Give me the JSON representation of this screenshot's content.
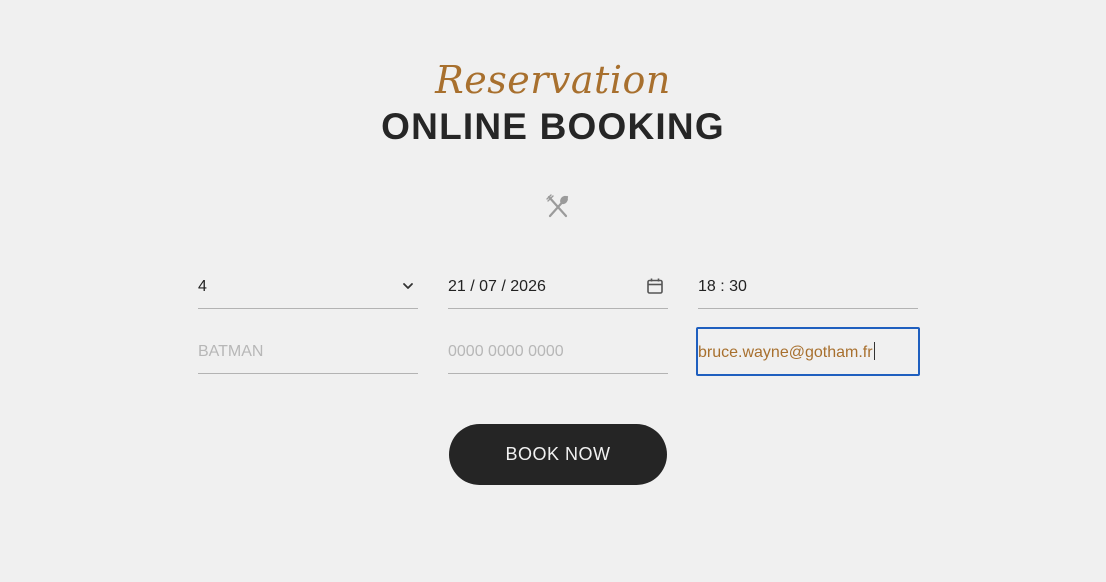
{
  "header": {
    "script_title": "Reservation",
    "title": "ONLINE BOOKING",
    "divider_icon": "fork-knife-icon"
  },
  "form": {
    "guests": {
      "value": "4",
      "icon": "chevron-down-icon"
    },
    "date": {
      "value": "21 / 07 / 2026",
      "icon": "calendar-icon"
    },
    "time": {
      "value": "18 : 30"
    },
    "name": {
      "value": "",
      "placeholder": "BATMAN"
    },
    "phone": {
      "value": "",
      "placeholder": "0000 0000 0000"
    },
    "email": {
      "value": "bruce.wayne@gotham.fr",
      "focused": true
    },
    "submit_label": "BOOK NOW"
  },
  "colors": {
    "accent": "#a8702e",
    "background": "#f0f0f0",
    "button": "#252525",
    "focus": "#1f5fbf"
  }
}
